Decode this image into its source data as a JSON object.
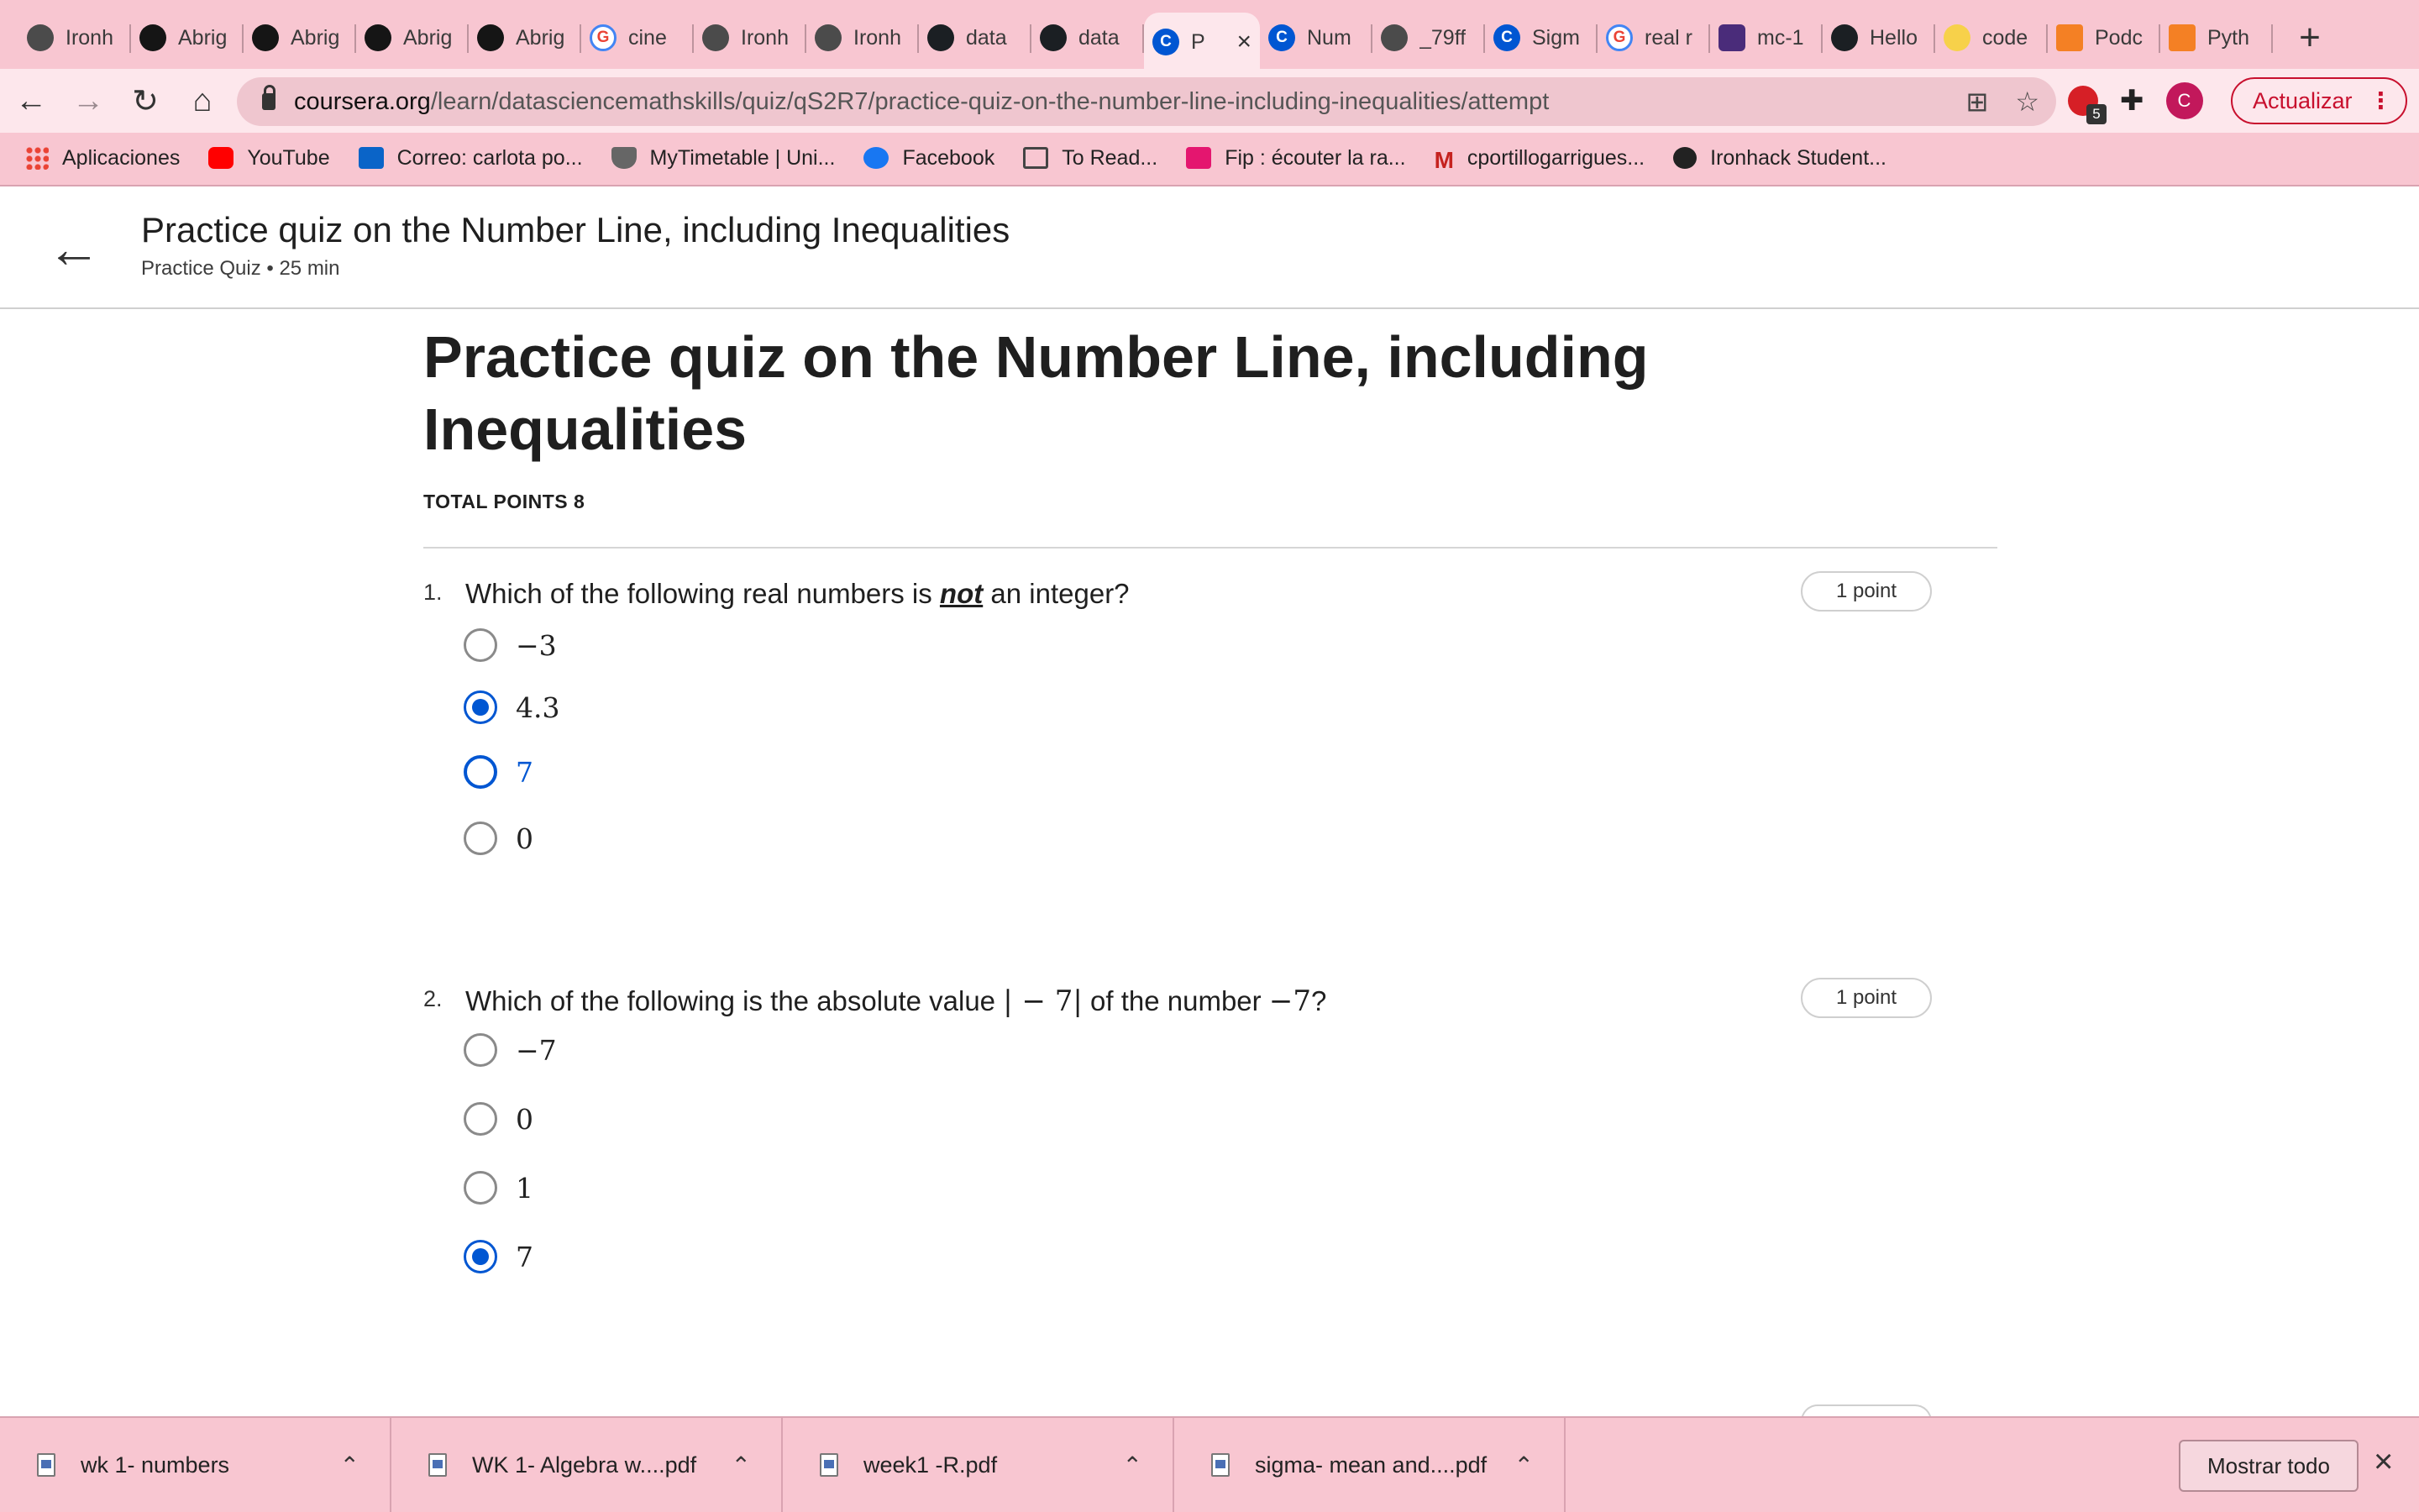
{
  "tabs": [
    {
      "title": "Ironh",
      "icon": "globe-icon"
    },
    {
      "title": "Abrig",
      "icon": "dark-circle-icon"
    },
    {
      "title": "Abrig",
      "icon": "dark-circle-icon"
    },
    {
      "title": "Abrig",
      "icon": "dark-circle-icon"
    },
    {
      "title": "Abrig",
      "icon": "dark-circle-icon"
    },
    {
      "title": "cine",
      "icon": "google-icon"
    },
    {
      "title": "Ironh",
      "icon": "globe-icon"
    },
    {
      "title": "Ironh",
      "icon": "globe-icon"
    },
    {
      "title": "data",
      "icon": "github-icon"
    },
    {
      "title": "data",
      "icon": "github-icon"
    },
    {
      "title": "P",
      "icon": "coursera-icon",
      "active": true
    },
    {
      "title": "Num",
      "icon": "coursera-icon"
    },
    {
      "title": "_79ff",
      "icon": "globe-icon"
    },
    {
      "title": "Sigm",
      "icon": "coursera-icon"
    },
    {
      "title": "real r",
      "icon": "google-icon"
    },
    {
      "title": "mc-1",
      "icon": "shield-icon"
    },
    {
      "title": "Hello",
      "icon": "github-icon"
    },
    {
      "title": "code",
      "icon": "pin-icon"
    },
    {
      "title": "Podc",
      "icon": "stackoverflow-icon"
    },
    {
      "title": "Pyth",
      "icon": "stackoverflow-icon"
    }
  ],
  "toolbar": {
    "url_domain": "coursera.org",
    "url_path": "/learn/datasciencemathskills/quiz/qS2R7/practice-quiz-on-the-number-line-including-inequalities/attempt",
    "extension_badge": "5",
    "avatar_letter": "C",
    "update_label": "Actualizar"
  },
  "bookmarks": [
    {
      "label": "Aplicaciones",
      "icon": "apps-grid-icon"
    },
    {
      "label": "YouTube",
      "icon": "youtube-icon"
    },
    {
      "label": "Correo: carlota po...",
      "icon": "outlook-icon"
    },
    {
      "label": "MyTimetable | Uni...",
      "icon": "crest-icon"
    },
    {
      "label": "Facebook",
      "icon": "facebook-icon"
    },
    {
      "label": "To Read...",
      "icon": "folder-icon"
    },
    {
      "label": "Fip : écouter la ra...",
      "icon": "fip-icon"
    },
    {
      "label": "cportillogarrigues...",
      "icon": "gmail-icon"
    },
    {
      "label": "Ironhack Student...",
      "icon": "globe-icon"
    }
  ],
  "header": {
    "title": "Practice quiz on the Number Line, including Inequalities",
    "subtitle": "Practice Quiz • 25 min"
  },
  "quiz": {
    "title": "Practice quiz on the Number Line, including Inequalities",
    "total_points": "TOTAL POINTS 8",
    "questions": [
      {
        "number": "1.",
        "text_before": "Which of the following real numbers is ",
        "text_emphasis": "not",
        "text_after": " an integer?",
        "points": "1 point",
        "options": [
          {
            "label": "−3",
            "state": "unchecked"
          },
          {
            "label": "4.3",
            "state": "checked"
          },
          {
            "label": "7",
            "state": "focused"
          },
          {
            "label": "0",
            "state": "unchecked"
          }
        ]
      },
      {
        "number": "2.",
        "text_before": "Which of the following is the absolute value ",
        "math_1": "| − 7|",
        "text_middle": " of the number ",
        "math_2": "−7",
        "text_after": "?",
        "points": "1 point",
        "options": [
          {
            "label": "−7",
            "state": "unchecked"
          },
          {
            "label": "0",
            "state": "unchecked"
          },
          {
            "label": "1",
            "state": "unchecked"
          },
          {
            "label": "7",
            "state": "checked"
          }
        ]
      }
    ]
  },
  "downloads": {
    "items": [
      {
        "name": "wk 1- numbers"
      },
      {
        "name": "WK 1- Algebra w....pdf"
      },
      {
        "name": "week1 -R.pdf"
      },
      {
        "name": "sigma- mean and....pdf"
      }
    ],
    "show_all_label": "Mostrar todo"
  },
  "colors": {
    "chrome_pink": "#f8c6d1",
    "accent_blue": "#0056d2",
    "update_red": "#c8102e"
  }
}
